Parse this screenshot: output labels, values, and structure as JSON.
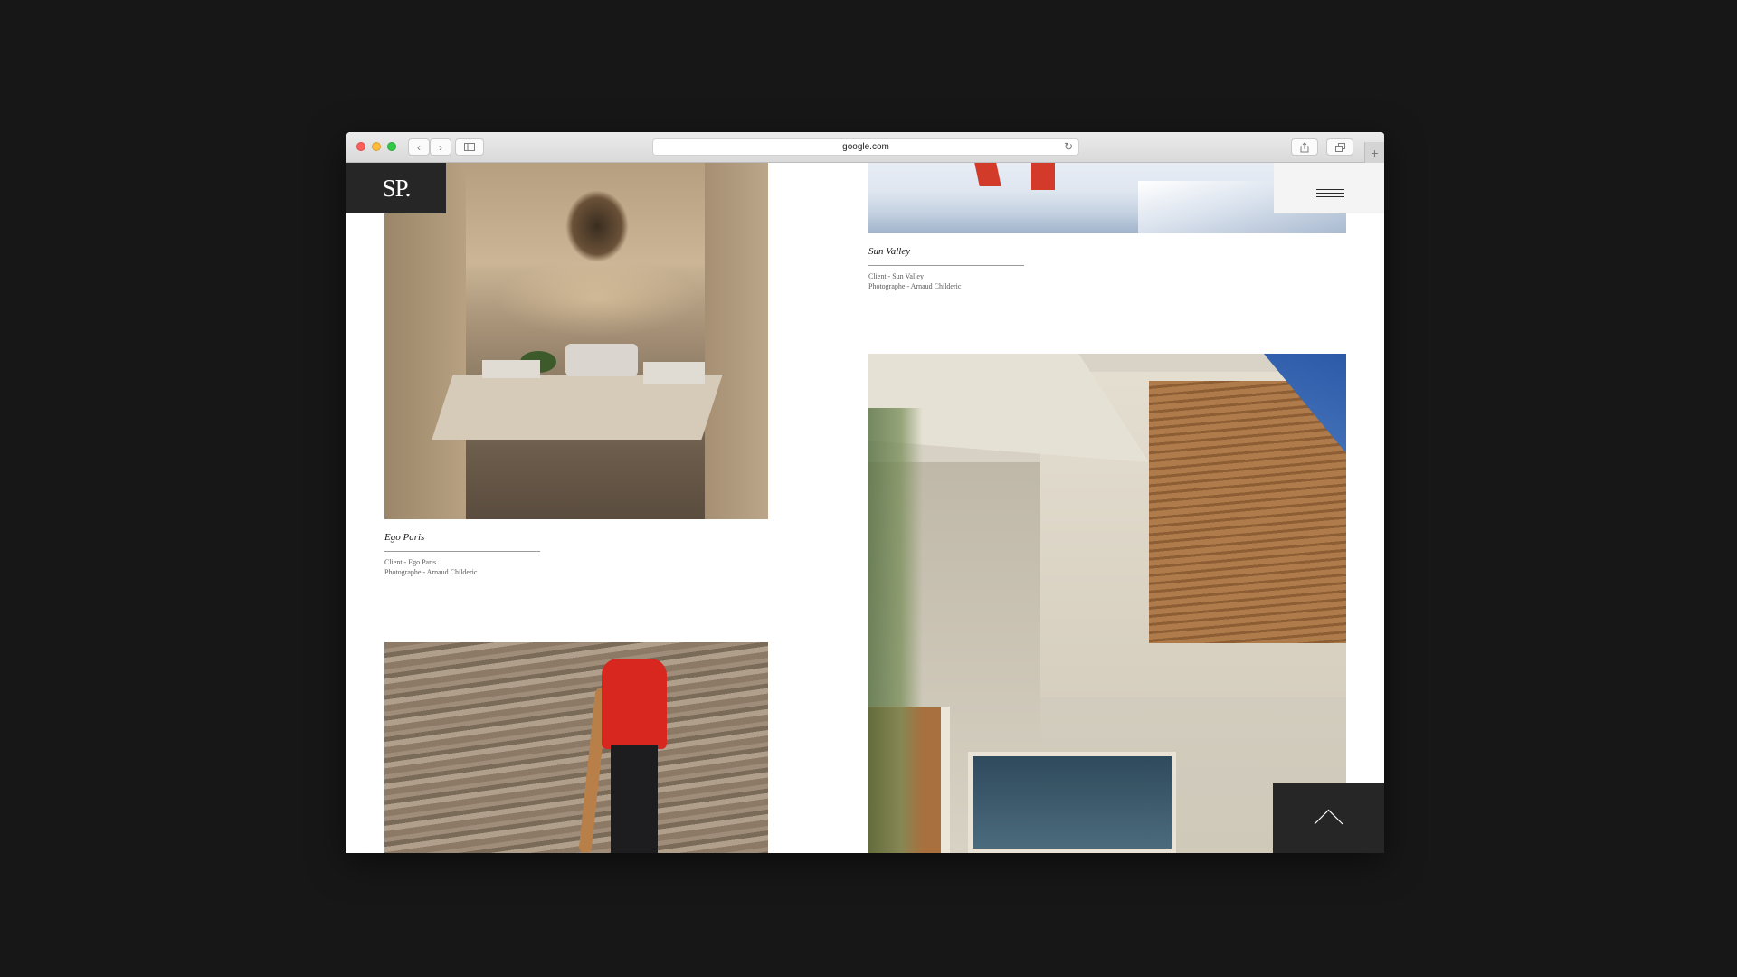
{
  "browser": {
    "url": "google.com",
    "back_icon": "‹",
    "forward_icon": "›",
    "reload_icon": "↻",
    "newtab_icon": "+"
  },
  "site": {
    "logo": "SP.",
    "projects": [
      {
        "title": "Sun Valley",
        "client": "Client - Sun Valley",
        "photographer": "Photographe - Arnaud Childeric"
      },
      {
        "title": "Ego Paris",
        "client": "Client - Ego Paris",
        "photographer": "Photographe - Arnaud Childeric"
      }
    ]
  },
  "colors": {
    "background": "#171717",
    "dark_panel": "#262626",
    "menu_panel": "#f4f4f4"
  },
  "icons": [
    "hamburger-menu-icon",
    "chevron-up-icon",
    "share-icon",
    "tabs-icon",
    "sidebar-icon"
  ]
}
